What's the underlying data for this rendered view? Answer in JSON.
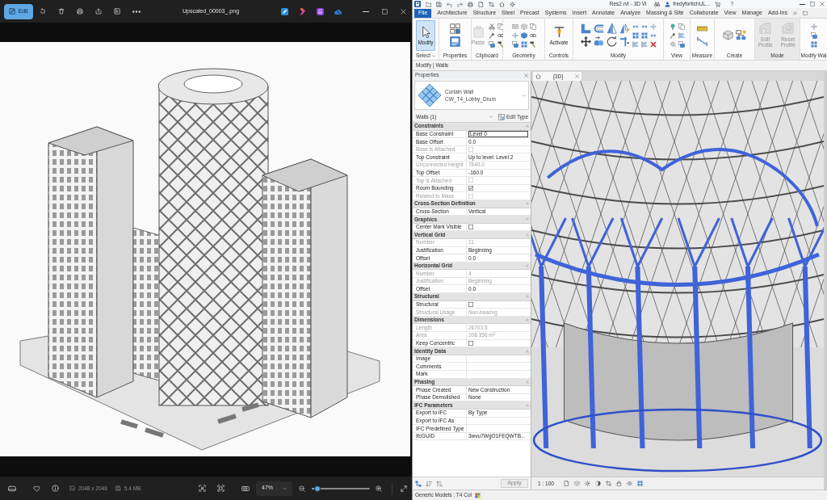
{
  "viewer": {
    "edit_button": "Edit",
    "file_name": "Upscaled_00003_.png",
    "dimensions": "2048 x 2048",
    "file_size": "5.4 MB",
    "zoom": {
      "value": "47%",
      "level": 0.1
    }
  },
  "revit": {
    "title": "Res2.rvt - 3D Vi",
    "user": "fredyfortichUL...",
    "help": "?",
    "tabs": [
      {
        "label": "File",
        "kind": "file"
      },
      {
        "label": "Architecture",
        "kind": "tab"
      },
      {
        "label": "Structure",
        "kind": "tab"
      },
      {
        "label": "Steel",
        "kind": "tab"
      },
      {
        "label": "Precast",
        "kind": "tab"
      },
      {
        "label": "Systems",
        "kind": "tab"
      },
      {
        "label": "Insert",
        "kind": "tab"
      },
      {
        "label": "Annotate",
        "kind": "tab"
      },
      {
        "label": "Analyze",
        "kind": "tab"
      },
      {
        "label": "Massing & Site",
        "kind": "tab"
      },
      {
        "label": "Collaborate",
        "kind": "tab"
      },
      {
        "label": "View",
        "kind": "tab"
      },
      {
        "label": "Manage",
        "kind": "tab"
      },
      {
        "label": "Add-Ins",
        "kind": "tab"
      }
    ],
    "ribbon_panels": [
      {
        "title": "Select",
        "dropdown": true,
        "disabled": false,
        "buttons": [
          {
            "label": "Modify",
            "selected": true,
            "disabled": false
          }
        ]
      },
      {
        "title": "Properties",
        "dropdown": false,
        "disabled": false
      },
      {
        "title": "Clipboard",
        "dropdown": false,
        "disabled": false,
        "buttons": [
          {
            "label": "Paste",
            "selected": false,
            "disabled": true
          }
        ]
      },
      {
        "title": "Geometry",
        "dropdown": false,
        "disabled": false
      },
      {
        "title": "Controls",
        "dropdown": false,
        "disabled": false,
        "buttons": [
          {
            "label": "Activate",
            "selected": false,
            "disabled": false
          }
        ]
      },
      {
        "title": "Modify",
        "dropdown": false,
        "disabled": false
      },
      {
        "title": "View",
        "dropdown": false,
        "disabled": false
      },
      {
        "title": "Measure",
        "dropdown": false,
        "disabled": false
      },
      {
        "title": "Create",
        "dropdown": false,
        "disabled": false
      },
      {
        "title": "Mode",
        "dropdown": false,
        "disabled": true,
        "buttons": [
          {
            "label": "Edit Profile",
            "selected": false,
            "disabled": true
          },
          {
            "label": "Reset Profile",
            "selected": false,
            "disabled": true
          }
        ]
      },
      {
        "title": "Modify Wal",
        "dropdown": false,
        "disabled": false
      }
    ],
    "options_bar": "Modify | Walls",
    "properties": {
      "title": "Properties",
      "type_family": "Curtain Wall",
      "type_name": "CW_T4_Lobby_Drum",
      "filter": "Walls (1)",
      "edit_type": "Edit Type",
      "groups": [
        {
          "title": "Constraints",
          "rows": [
            {
              "label": "Base Constraint",
              "value": "Level 0",
              "kind": "input",
              "disabled": false
            },
            {
              "label": "Base Offset",
              "value": "0.0",
              "kind": "text",
              "disabled": false
            },
            {
              "label": "Base is Attached",
              "kind": "checkbox",
              "checked": false,
              "disabled": true
            },
            {
              "label": "Top Constraint",
              "value": "Up to level: Level 2",
              "kind": "text",
              "disabled": false
            },
            {
              "label": "Unconnected Height",
              "value": "7840.0",
              "kind": "text",
              "disabled": true
            },
            {
              "label": "Top Offset",
              "value": "-160.0",
              "kind": "text",
              "disabled": false
            },
            {
              "label": "Top is Attached",
              "kind": "checkbox",
              "checked": false,
              "disabled": true
            },
            {
              "label": "Room Bounding",
              "kind": "checkbox",
              "checked": true,
              "disabled": false
            },
            {
              "label": "Related to Mass",
              "kind": "checkbox",
              "checked": false,
              "disabled": true
            }
          ]
        },
        {
          "title": "Cross-Section Definition",
          "rows": [
            {
              "label": "Cross-Section",
              "value": "Vertical",
              "kind": "text",
              "disabled": false
            }
          ]
        },
        {
          "title": "Graphics",
          "rows": [
            {
              "label": "Center Mark Visible",
              "kind": "checkbox",
              "checked": false,
              "disabled": false
            }
          ]
        },
        {
          "title": "Vertical Grid",
          "rows": [
            {
              "label": "Number",
              "value": "11",
              "kind": "text",
              "disabled": true
            },
            {
              "label": "Justification",
              "value": "Beginning",
              "kind": "text",
              "disabled": false
            },
            {
              "label": "Offset",
              "value": "0.0",
              "kind": "text",
              "disabled": false
            }
          ]
        },
        {
          "title": "Horizontal Grid",
          "rows": [
            {
              "label": "Number",
              "value": "4",
              "kind": "text",
              "disabled": true
            },
            {
              "label": "Justification",
              "value": "Beginning",
              "kind": "text",
              "disabled": true
            },
            {
              "label": "Offset",
              "value": "0.0",
              "kind": "text",
              "disabled": false
            }
          ]
        },
        {
          "title": "Structural",
          "rows": [
            {
              "label": "Structural",
              "kind": "checkbox",
              "checked": false,
              "disabled": false
            },
            {
              "label": "Structural Usage",
              "value": "Non-bearing",
              "kind": "text",
              "disabled": true
            }
          ]
        },
        {
          "title": "Dimensions",
          "rows": [
            {
              "label": "Length",
              "value": "26703.5",
              "kind": "text",
              "disabled": true
            },
            {
              "label": "Area",
              "value": "208.356 m$^{2}$",
              "kind": "text",
              "disabled": true
            },
            {
              "label": "Keep Concentric",
              "kind": "checkbox",
              "checked": false,
              "disabled": false
            }
          ]
        },
        {
          "title": "Identity Data",
          "rows": [
            {
              "label": "Image",
              "kind": "text",
              "disabled": false
            },
            {
              "label": "Comments",
              "kind": "text",
              "disabled": false
            },
            {
              "label": "Mark",
              "kind": "text",
              "disabled": false
            }
          ]
        },
        {
          "title": "Phasing",
          "rows": [
            {
              "label": "Phase Created",
              "value": "New Construction",
              "kind": "text",
              "disabled": false
            },
            {
              "label": "Phase Demolished",
              "value": "None",
              "kind": "text",
              "disabled": false
            }
          ]
        },
        {
          "title": "IFC Parameters",
          "rows": [
            {
              "label": "Export to IFC",
              "value": "By Type",
              "kind": "text",
              "disabled": false
            },
            {
              "label": "Export to IFC As",
              "kind": "text",
              "disabled": false
            },
            {
              "label": "IFC Predefined Type",
              "kind": "text",
              "disabled": false
            },
            {
              "label": "IfcGUID",
              "value": "3wvu7WgO1FEQWTB...",
              "kind": "text",
              "disabled": false
            }
          ]
        }
      ],
      "apply": {
        "label": "Apply",
        "disabled": true
      }
    },
    "view_tab": "{3D}",
    "view_scale": "1 : 100",
    "status_bar": "Generic Models : T4 Col"
  }
}
